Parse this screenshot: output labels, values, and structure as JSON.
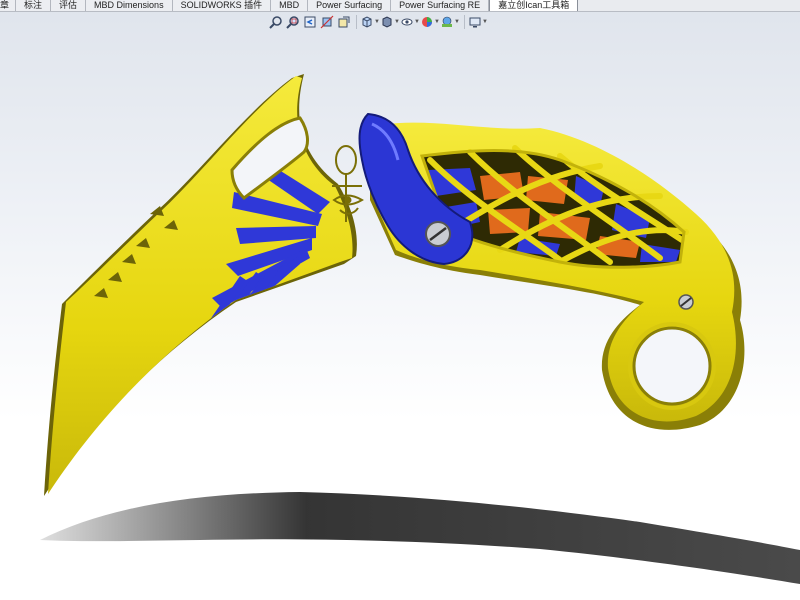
{
  "command_manager": {
    "tabs": [
      {
        "label": "特征",
        "visible": "章"
      },
      {
        "label": "标注"
      },
      {
        "label": "评估"
      },
      {
        "label": "MBD Dimensions"
      },
      {
        "label": "SOLIDWORKS 插件"
      },
      {
        "label": "MBD"
      },
      {
        "label": "Power Surfacing"
      },
      {
        "label": "Power Surfacing RE"
      },
      {
        "label": "嘉立创Ican工具箱",
        "active": true
      }
    ]
  },
  "heads_up_toolbar": {
    "items": [
      {
        "icon": "zoom-to-fit-icon"
      },
      {
        "icon": "zoom-to-area-icon"
      },
      {
        "icon": "previous-view-icon"
      },
      {
        "icon": "section-view-icon"
      },
      {
        "icon": "dynamic-annotation-views-icon"
      },
      {
        "icon": "view-orientation-icon"
      },
      {
        "icon": "display-style-icon"
      },
      {
        "icon": "hide-show-items-icon"
      },
      {
        "icon": "edit-appearance-icon"
      },
      {
        "icon": "apply-scene-icon"
      },
      {
        "icon": "view-settings-icon"
      }
    ]
  },
  "model": {
    "name": "karambit knife",
    "colors": {
      "body_yellow": "#ecdc12",
      "accent_blue": "#2f38d8",
      "accent_orange": "#e06a1c",
      "edge_dark": "#6c6408",
      "shadow": "#2a2a2a"
    }
  }
}
